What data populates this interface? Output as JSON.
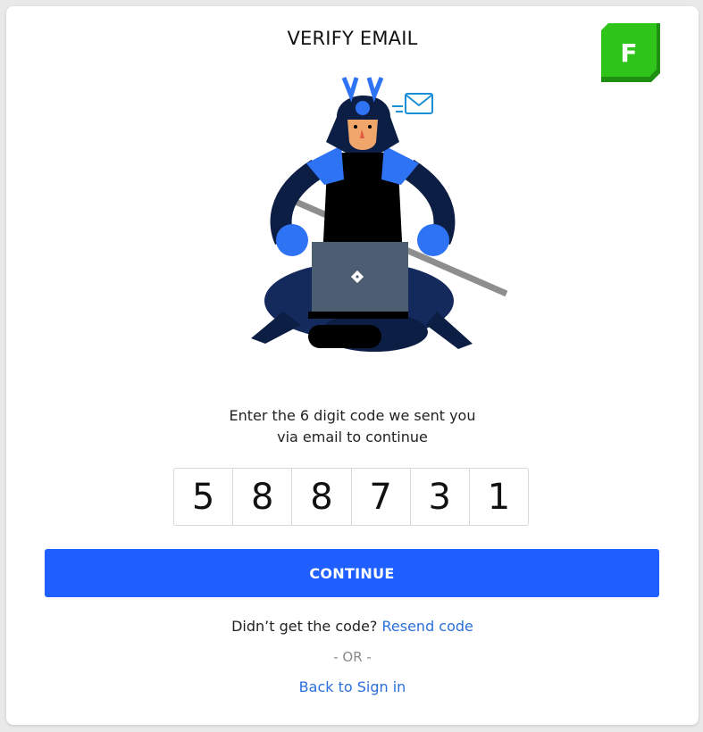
{
  "header": {
    "title": "VERIFY EMAIL",
    "logo_letter": "F"
  },
  "instruction": {
    "line1": "Enter the 6 digit code we sent you",
    "line2": "via email to continue"
  },
  "code": {
    "digits": [
      "5",
      "8",
      "8",
      "7",
      "3",
      "1"
    ]
  },
  "continue_label": "CONTINUE",
  "resend": {
    "prompt": "Didn’t get the code?",
    "link": "Resend code"
  },
  "or_text": "- OR -",
  "back_link": "Back to Sign in",
  "colors": {
    "primary": "#1f5fff",
    "link": "#2a6fdb",
    "logo_green": "#2ec41a",
    "armor_blue": "#2f73f5",
    "navy": "#0d1e45"
  }
}
